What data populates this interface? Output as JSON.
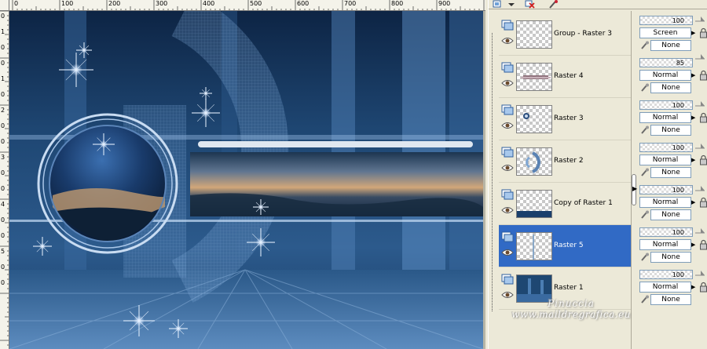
{
  "ruler": {
    "top_labels": [
      "0",
      "100",
      "200",
      "300",
      "400",
      "500",
      "600",
      "700",
      "800",
      "900"
    ],
    "left_labels": [
      "0",
      "1",
      "0",
      "0",
      "1",
      "0",
      "2",
      "0",
      "0",
      "3",
      "0",
      "0",
      "4",
      "0",
      "0",
      "5",
      "0",
      "0"
    ]
  },
  "layers": [
    {
      "name": "Group - Raster 3",
      "opacity": "100",
      "blend": "Screen",
      "mask": "None",
      "selected": false,
      "thumb": "empty"
    },
    {
      "name": "Raster 4",
      "opacity": "85",
      "blend": "Normal",
      "mask": "None",
      "selected": false,
      "thumb": "streak"
    },
    {
      "name": "Raster 3",
      "opacity": "100",
      "blend": "Normal",
      "mask": "None",
      "selected": false,
      "thumb": "dot"
    },
    {
      "name": "Raster 2",
      "opacity": "100",
      "blend": "Normal",
      "mask": "None",
      "selected": false,
      "thumb": "arc"
    },
    {
      "name": "Copy of Raster 1",
      "opacity": "100",
      "blend": "Normal",
      "mask": "None",
      "selected": false,
      "thumb": "band"
    },
    {
      "name": "Raster 5",
      "opacity": "100",
      "blend": "Normal",
      "mask": "None",
      "selected": true,
      "thumb": "line"
    },
    {
      "name": "Raster 1",
      "opacity": "100",
      "blend": "Normal",
      "mask": "None",
      "selected": false,
      "thumb": "full"
    }
  ],
  "watermark": {
    "line1": "Pinuccia",
    "line2": "www.maildregrafica.eu"
  },
  "colors": {
    "selection": "#316ac5",
    "canvas_deep": "#0c1f3a",
    "canvas_mid": "#2c5585",
    "canvas_light": "#7aa6d6"
  }
}
